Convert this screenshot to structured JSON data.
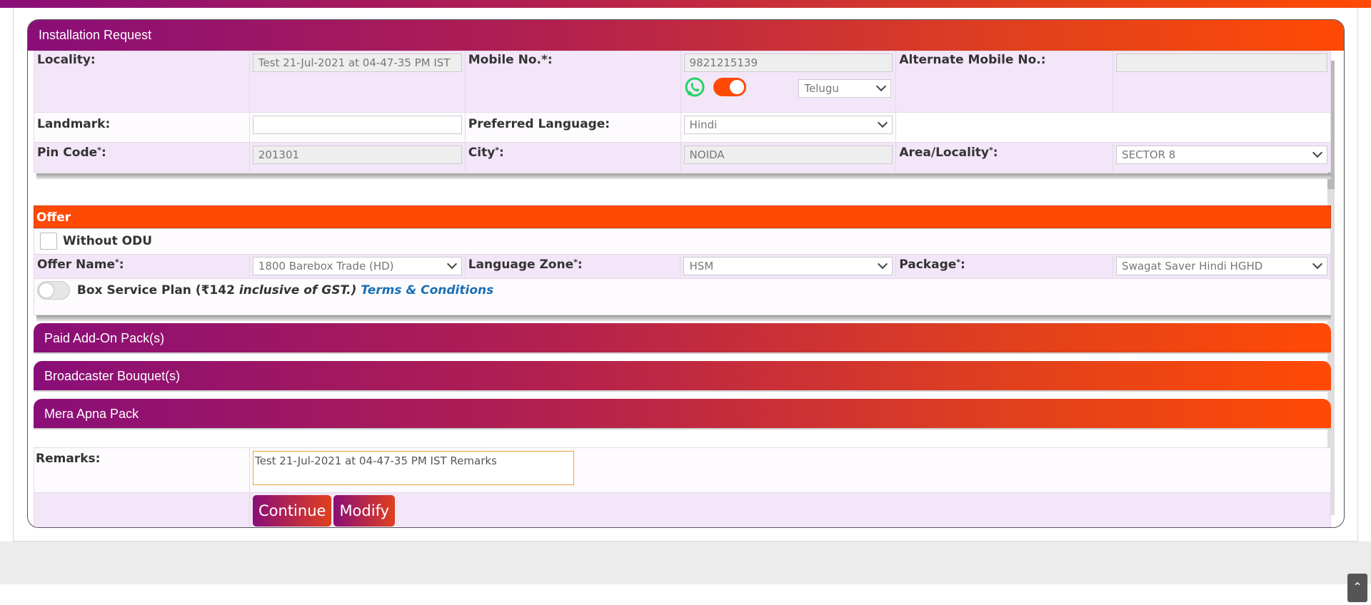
{
  "card": {
    "title": "Installation Request"
  },
  "contact": {
    "locality_label": "Locality:",
    "locality_value": "Test 21-Jul-2021 at 04-47-35 PM IST",
    "mobile_label": "Mobile No.*:",
    "mobile_value": "9821215139",
    "alt_mobile_label": "Alternate Mobile No.:",
    "alt_mobile_value": "",
    "language_select": "Telugu",
    "landmark_label": "Landmark:",
    "landmark_value": "",
    "preferred_language_label": "Preferred Language:",
    "preferred_language_value": "Hindi",
    "pincode_label": "Pin Code",
    "pincode_value": "201301",
    "city_label": "City",
    "city_value": "NOIDA",
    "area_label": "Area/Locality",
    "area_value": "SECTOR 8",
    "required_mark": "*",
    "colon": ":"
  },
  "offer": {
    "header": "Offer",
    "without_odu_label": "Without ODU",
    "offer_name_label": "Offer Name",
    "offer_name_value": "1800 Barebox Trade (HD)",
    "language_zone_label": "Language Zone",
    "language_zone_value": "HSM",
    "package_label": "Package",
    "package_value": "Swagat Saver Hindi HGHD",
    "box_service_prefix": "Box Service Plan (₹142 ",
    "box_service_italic": "inclusive of GST.)",
    "terms_link": "Terms & Conditions"
  },
  "accordions": {
    "paid_addon": "Paid Add-On Pack(s)",
    "broadcaster": "Broadcaster Bouquet(s)",
    "mera_apna": "Mera Apna Pack"
  },
  "remarks": {
    "label": "Remarks:",
    "value": "Test 21-Jul-2021 at 04-47-35 PM IST Remarks"
  },
  "buttons": {
    "continue": "Continue",
    "modify": "Modify"
  },
  "colors": {
    "accent_orange": "#ff4a05",
    "accent_purple": "#8a0e78",
    "row_lavender": "#f3e6f8",
    "whatsapp_green": "#25d366"
  },
  "icons": {
    "whatsapp": "whatsapp-icon",
    "scroll_top": "double-chevron-up-icon",
    "dropdown": "chevron-down-icon"
  }
}
